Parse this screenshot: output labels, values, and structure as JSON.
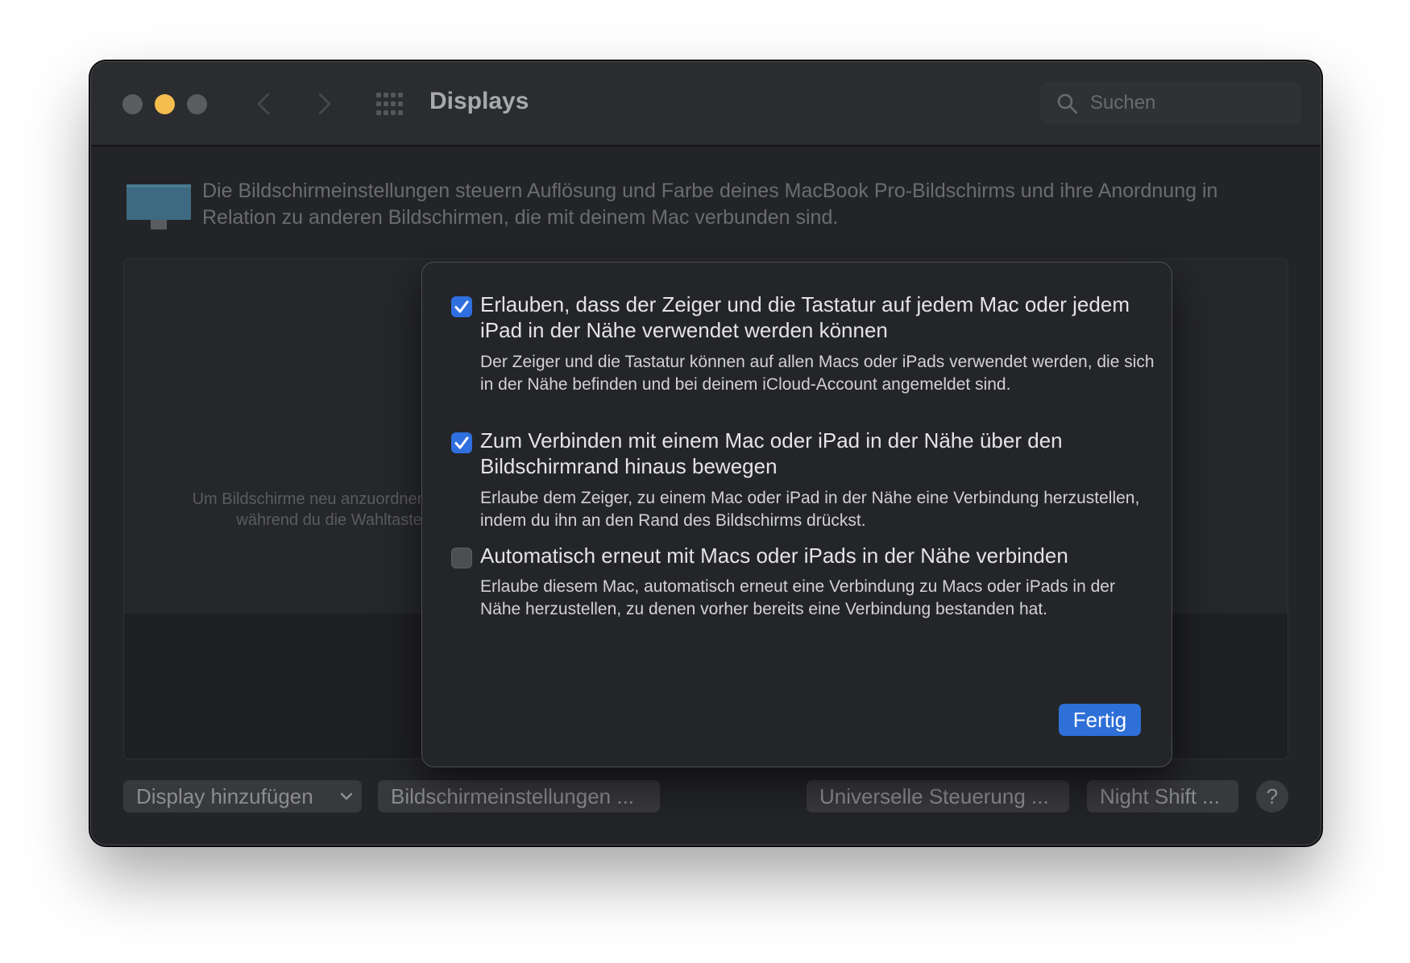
{
  "window": {
    "title": "Displays",
    "search_placeholder": "Suchen"
  },
  "icons": {
    "close": "close-icon",
    "minimize": "minimize-icon",
    "maximize": "maximize-icon",
    "back": "chevron-left-icon",
    "forward": "chevron-right-icon",
    "grid": "grid-icon",
    "search": "search-icon",
    "monitor": "monitor-icon",
    "checkmark": "checkmark-icon",
    "dropdown": "chevron-down-icon"
  },
  "colors": {
    "accent": "#2f6fe0",
    "traffic_minimize": "#f5bd4f",
    "window_bg": "#232427"
  },
  "description": "Die Bildschirmeinstellungen steuern Auflösung und Farbe deines MacBook Pro-Bildschirms und ihre Anordnung in Relation zu anderen Bildschirmen, die mit deinem Mac verbunden sind.",
  "arrangement_hint": "Um Bildschirme neu anzuordnen, ziehe sie an die gewünschte Position. Um Bildschirme zu synchronisieren, bewege sie übereinander, während du die Wahltaste gedrückt hältst. Um die Menüleiste neu zu platzieren, bewege sie auf einen anderen Bildschirm.",
  "bottom_bar": {
    "add_display": "Display hinzufügen",
    "display_settings": "Bildschirmeinstellungen ...",
    "universal_control": "Universelle Steuerung ...",
    "night_shift": "Night Shift ...",
    "help": "?"
  },
  "sheet": {
    "options": [
      {
        "label": "Erlauben, dass der Zeiger und die Tastatur auf jedem Mac oder jedem iPad in der Nähe verwendet werden können",
        "description": "Der Zeiger und die Tastatur können auf allen Macs oder iPads verwendet werden, die sich in der Nähe befinden und bei deinem iCloud-Account angemeldet sind.",
        "checked": true
      },
      {
        "label": "Zum Verbinden mit einem Mac oder iPad in der Nähe über den Bildschirmrand hinaus bewegen",
        "description": "Erlaube dem Zeiger, zu einem Mac oder iPad in der Nähe eine Verbindung herzustellen, indem du ihn an den Rand des Bildschirms drückst.",
        "checked": true
      },
      {
        "label": "Automatisch erneut mit Macs oder iPads in der Nähe verbinden",
        "description": "Erlaube diesem Mac, automatisch erneut eine Verbindung zu Macs oder iPads in der Nähe herzustellen, zu denen vorher bereits eine Verbindung bestanden hat.",
        "checked": false
      }
    ],
    "done_label": "Fertig"
  }
}
